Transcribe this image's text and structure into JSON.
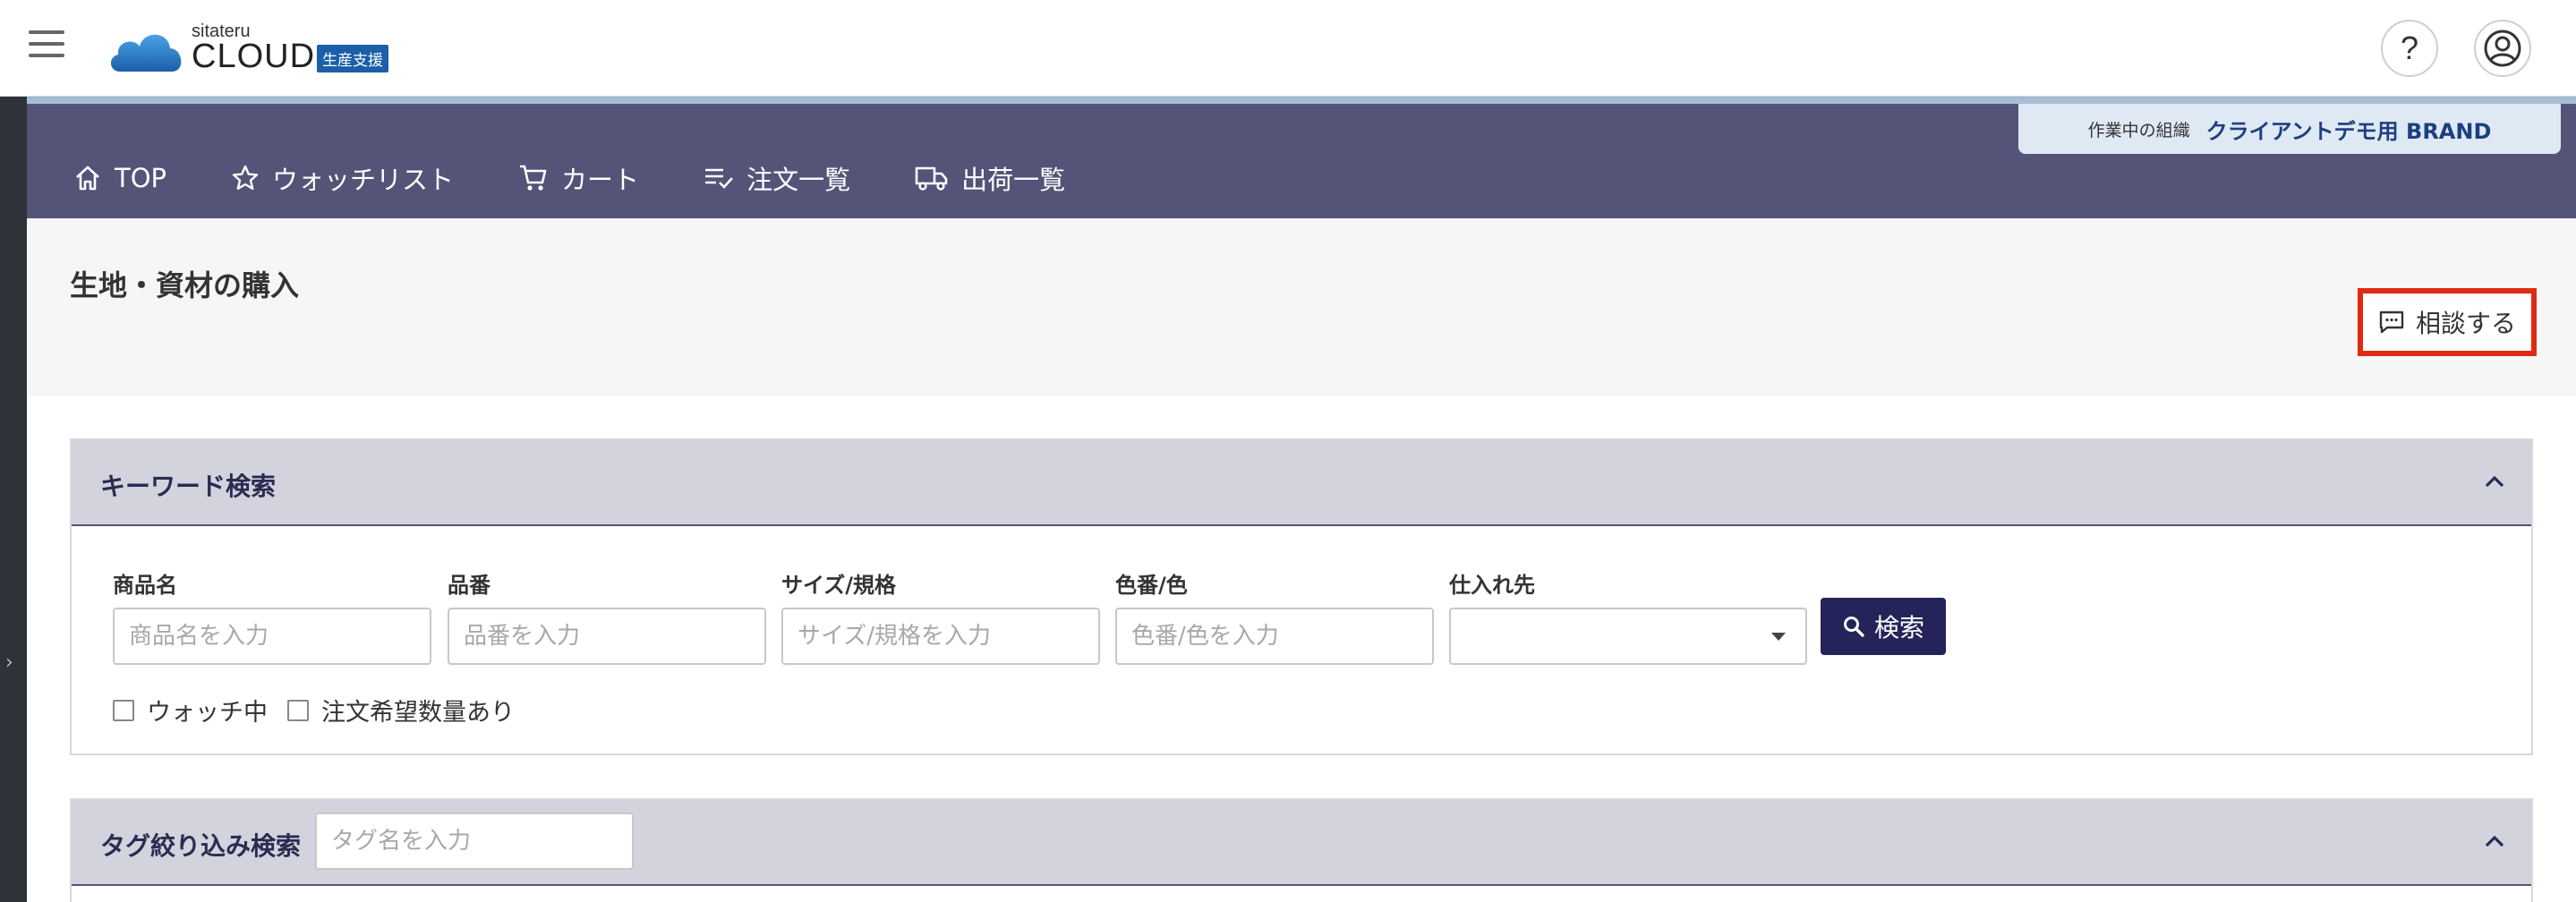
{
  "header": {
    "logo_small": "sitateru",
    "logo_big": "CLOUD",
    "logo_badge": "生産支援",
    "help_label": "?"
  },
  "nav": {
    "items": [
      {
        "label": "TOP",
        "icon": "home-icon"
      },
      {
        "label": "ウォッチリスト",
        "icon": "star-icon"
      },
      {
        "label": "カート",
        "icon": "cart-icon"
      },
      {
        "label": "注文一覧",
        "icon": "checklist-icon"
      },
      {
        "label": "出荷一覧",
        "icon": "truck-icon"
      }
    ],
    "org_label": "作業中の組織",
    "org_name": "クライアントデモ用 BRAND"
  },
  "page": {
    "title": "生地・資材の購入",
    "consult_label": "相談する"
  },
  "keyword_search": {
    "title": "キーワード検索",
    "fields": [
      {
        "label": "商品名",
        "placeholder": "商品名を入力"
      },
      {
        "label": "品番",
        "placeholder": "品番を入力"
      },
      {
        "label": "サイズ/規格",
        "placeholder": "サイズ/規格を入力"
      },
      {
        "label": "色番/色",
        "placeholder": "色番/色を入力"
      }
    ],
    "supplier_label": "仕入れ先",
    "supplier_value": "",
    "search_label": "検索",
    "checkboxes": [
      {
        "label": "ウォッチ中",
        "checked": false
      },
      {
        "label": "注文希望数量あり",
        "checked": false
      }
    ]
  },
  "tag_search": {
    "title": "タグ絞り込み検索",
    "placeholder": "タグ名を入力"
  },
  "colors": {
    "nav_bg": "#545479",
    "accent_dark": "#24245a",
    "highlight": "#e02a12",
    "brand_blue": "#1b5fa8"
  }
}
